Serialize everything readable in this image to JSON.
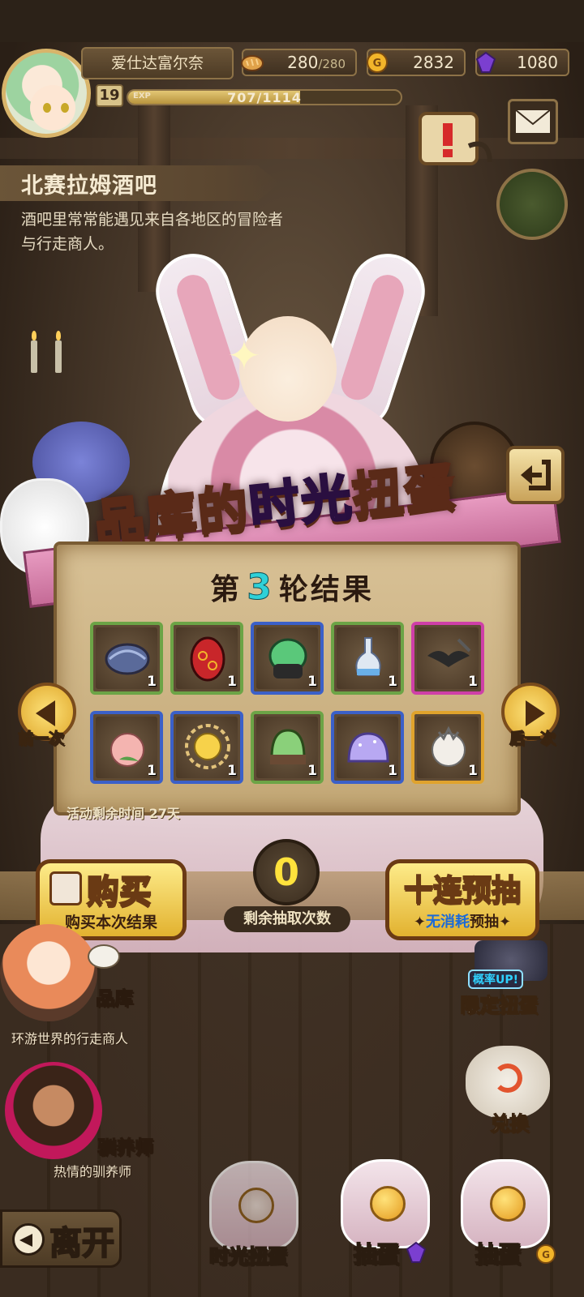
{
  "hud": {
    "player_name": "爱仕达富尔奈",
    "level": "19",
    "exp_label": "EXP",
    "exp_text": "707/1114",
    "exp_progress": 0.63,
    "bread": "280",
    "bread_max": "/280",
    "gold": "2832",
    "gem": "1080"
  },
  "location": {
    "title": "北赛拉姆酒吧",
    "description": "酒吧里常常能遇见来自各地区的冒险者与行走商人。"
  },
  "gacha": {
    "title_part1": "品库的",
    "title_highlight": "时光",
    "title_part2": "扭蛋",
    "round_prefix": "第",
    "round_number": "3",
    "round_suffix": "轮结果",
    "prev_label": "前一次",
    "next_label": "后一次",
    "event_time": "活动剩余时间 27天",
    "remaining_count": "0",
    "remaining_label": "剩余抽取次数",
    "buy_title": "购买",
    "buy_sub": "购买本次结果",
    "ten_title": "十连预抽",
    "ten_sub_free": "无消耗",
    "ten_sub_rest": "预抽",
    "items": [
      {
        "icon": "shell-icon",
        "rarity": "green",
        "qty": "1"
      },
      {
        "icon": "red-egg-icon",
        "rarity": "green",
        "qty": "1"
      },
      {
        "icon": "green-slime-armor-icon",
        "rarity": "blue",
        "qty": "1"
      },
      {
        "icon": "potion-bottle-icon",
        "rarity": "green",
        "qty": "1"
      },
      {
        "icon": "bat-trident-icon",
        "rarity": "pink",
        "qty": "1"
      },
      {
        "icon": "peach-icon",
        "rarity": "blue",
        "qty": "1"
      },
      {
        "icon": "sun-icon",
        "rarity": "blue",
        "qty": "1"
      },
      {
        "icon": "green-slime-icon",
        "rarity": "green",
        "qty": "1"
      },
      {
        "icon": "purple-slime-icon",
        "rarity": "blue",
        "qty": "1"
      },
      {
        "icon": "white-bunny-crown-icon",
        "rarity": "gold",
        "qty": "1"
      }
    ]
  },
  "npcs": [
    {
      "name": "品库",
      "desc": "环游世界的行走商人"
    },
    {
      "name": "驯养师",
      "desc": "热情的驯养师"
    }
  ],
  "side": {
    "rate_up": "概率UP!",
    "limited": "限定扭蛋",
    "exchange": "兑换"
  },
  "bottom": {
    "leave": "离开",
    "time_gacha": "时光扭蛋",
    "draw_gem": "抽蛋",
    "draw_gold": "抽蛋"
  },
  "colors": {
    "gold_accent": "#ffe23c",
    "round_number": "#2fd1d8",
    "gem_purple": "#7b3fd0",
    "rarity_green": "#6ca446",
    "rarity_blue": "#3b60c8",
    "rarity_pink": "#cf3fa8",
    "rarity_gold": "#e0a32c"
  }
}
